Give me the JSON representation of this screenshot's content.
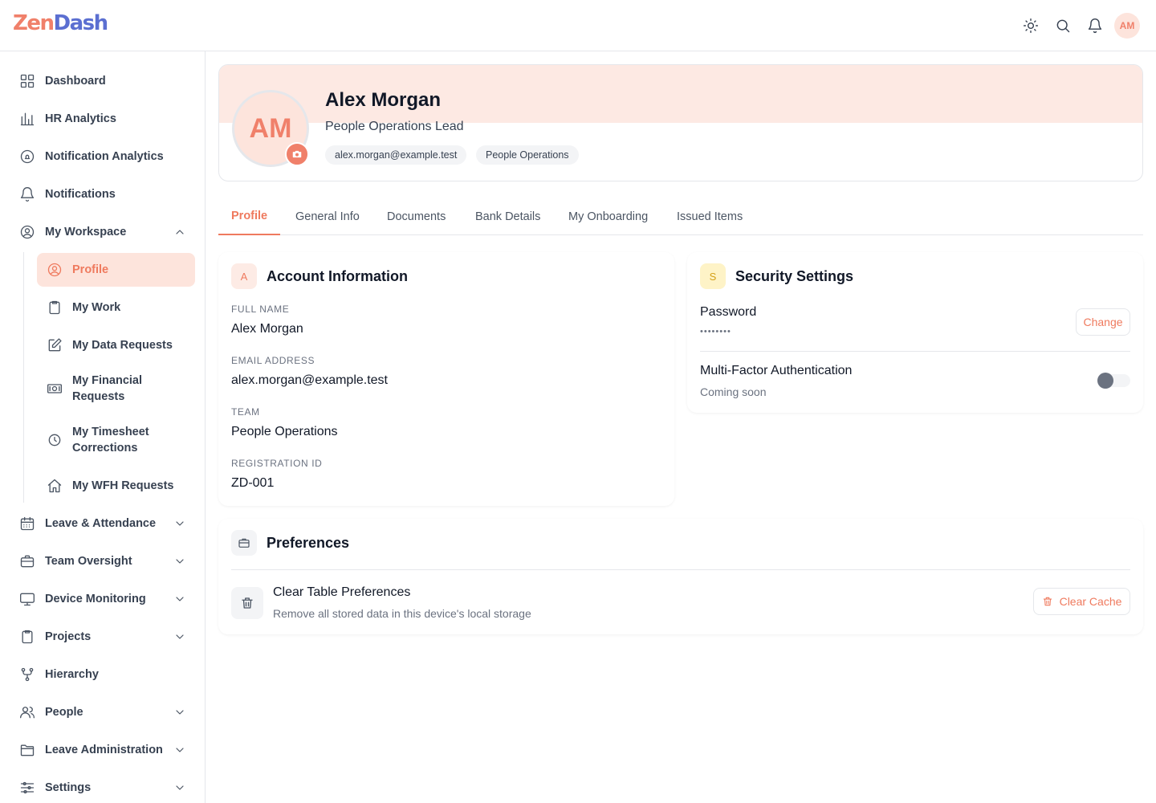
{
  "app": {
    "logo_part1": "Zen",
    "logo_part2": "Dash",
    "user_initials": "AM"
  },
  "topbar_icons": [
    "sun-icon",
    "search-icon",
    "bell-icon"
  ],
  "sidebar": {
    "items": [
      {
        "label": "Dashboard",
        "icon": "grid-icon"
      },
      {
        "label": "HR Analytics",
        "icon": "bar-chart-icon"
      },
      {
        "label": "Notification Analytics",
        "icon": "bell-circle-icon"
      },
      {
        "label": "Notifications",
        "icon": "bell-icon"
      },
      {
        "label": "My Workspace",
        "icon": "user-circle-icon",
        "expanded": true
      },
      {
        "label": "Leave & Attendance",
        "icon": "calendar-icon"
      },
      {
        "label": "Team Oversight",
        "icon": "briefcase-icon"
      },
      {
        "label": "Device Monitoring",
        "icon": "monitor-icon"
      },
      {
        "label": "Projects",
        "icon": "clipboard-icon"
      },
      {
        "label": "Hierarchy",
        "icon": "branch-icon"
      },
      {
        "label": "People",
        "icon": "users-icon"
      },
      {
        "label": "Leave Administration",
        "icon": "folder-icon"
      },
      {
        "label": "Settings",
        "icon": "sliders-icon"
      }
    ],
    "workspace_items": [
      {
        "label": "Profile",
        "icon": "user-circle-icon",
        "active": true
      },
      {
        "label": "My Work",
        "icon": "clipboard-icon"
      },
      {
        "label": "My Data Requests",
        "icon": "edit-icon"
      },
      {
        "label": "My Financial Requests",
        "icon": "money-icon"
      },
      {
        "label": "My Timesheet Corrections",
        "icon": "clock-icon"
      },
      {
        "label": "My WFH Requests",
        "icon": "home-icon"
      }
    ]
  },
  "profile": {
    "initials": "AM",
    "name": "Alex Morgan",
    "role": "People Operations Lead",
    "email_chip": "alex.morgan@example.test",
    "team_chip": "People Operations"
  },
  "tabs": [
    "Profile",
    "General Info",
    "Documents",
    "Bank Details",
    "My Onboarding",
    "Issued Items"
  ],
  "active_tab": "Profile",
  "account": {
    "badge": "A",
    "title": "Account Information",
    "fields": [
      {
        "label": "FULL NAME",
        "value": "Alex Morgan"
      },
      {
        "label": "EMAIL ADDRESS",
        "value": "alex.morgan@example.test"
      },
      {
        "label": "TEAM",
        "value": "People Operations"
      },
      {
        "label": "REGISTRATION ID",
        "value": "ZD-001"
      }
    ]
  },
  "security": {
    "badge": "S",
    "title": "Security Settings",
    "password_label": "Password",
    "password_mask": "••••••••",
    "change_label": "Change",
    "mfa_label": "Multi-Factor Authentication",
    "mfa_status": "Coming soon",
    "mfa_enabled": false
  },
  "preferences": {
    "title": "Preferences",
    "item_title": "Clear Table Preferences",
    "item_desc": "Remove all stored data in this device's local storage",
    "button_label": "Clear Cache"
  },
  "colors": {
    "accent": "#ef7a5e",
    "accent_light": "#fde4dc",
    "security_badge": "#fef3c7"
  }
}
